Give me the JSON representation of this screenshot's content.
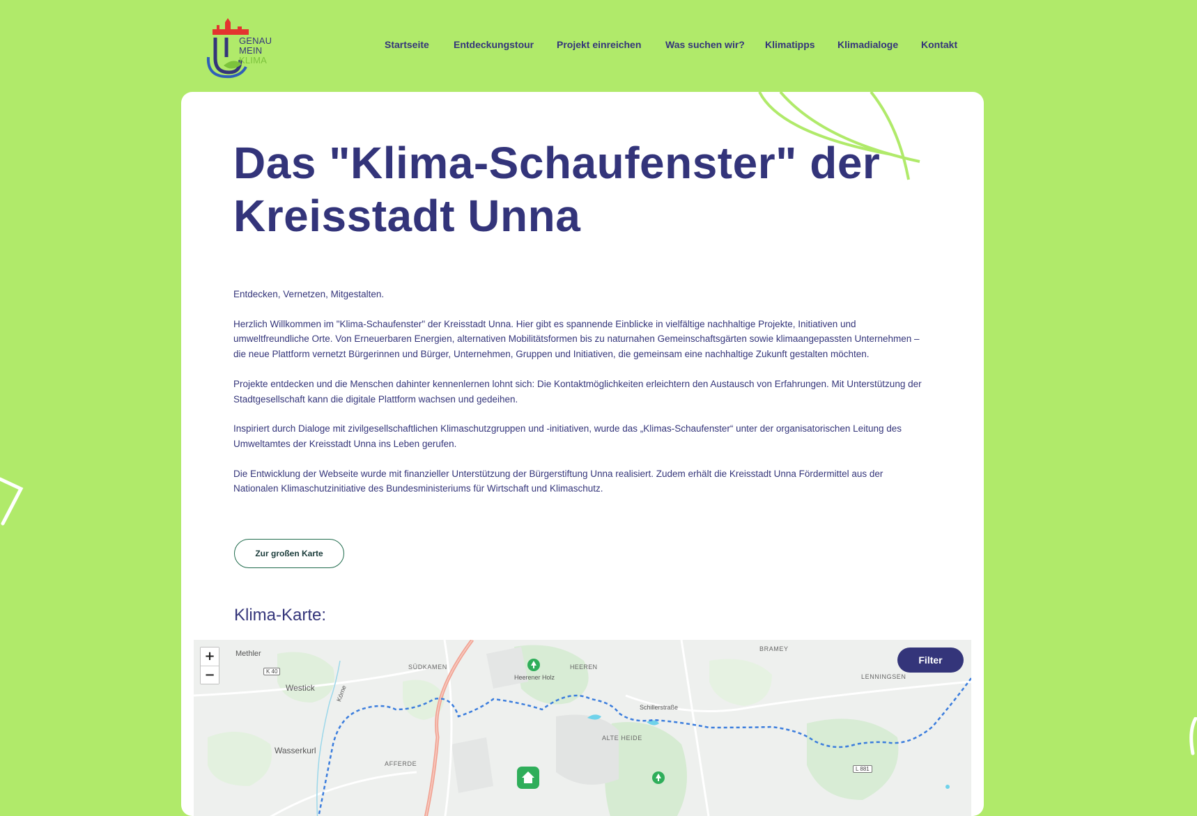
{
  "header": {
    "logo": {
      "line1": "GENAU",
      "line2": "MEIN",
      "line3": "KLIMA"
    },
    "nav": [
      {
        "label": "Startseite"
      },
      {
        "label": "Entdeckungstour"
      },
      {
        "label": "Projekt einreichen"
      },
      {
        "label": "Was suchen wir?"
      },
      {
        "label": "Klimatipps"
      },
      {
        "label": "Klimadialoge"
      },
      {
        "label": "Kontakt"
      }
    ]
  },
  "main": {
    "title_line1": "Das \"Klima-Schaufenster\" der",
    "title_line2": "Kreisstadt Unna",
    "paragraphs": [
      "Entdecken, Vernetzen, Mitgestalten.",
      "Herzlich Willkommen im \"Klima-Schaufenster\" der Kreisstadt Unna. Hier gibt es spannende Einblicke in vielfältige nachhaltige Projekte, Initiativen und umweltfreundliche Orte. Von Erneuerbaren Energien, alternativen Mobilitätsformen bis zu naturnahen Gemeinschaftsgärten sowie klimaangepassten Unternehmen – die neue Plattform vernetzt Bürgerinnen und Bürger, Unternehmen, Gruppen und Initiativen, die gemeinsam eine nachhaltige Zukunft gestalten möchten.",
      "Projekte entdecken und die Menschen dahinter kennenlernen lohnt sich: Die Kontaktmöglichkeiten erleichtern den Austausch von Erfahrungen. Mit Unterstützung der Stadtgesellschaft kann die digitale Plattform wachsen und gedeihen.",
      "Inspiriert durch Dialoge mit zivilgesellschaftlichen Klimaschutzgruppen und -initiativen, wurde das „Klimas-Schaufenster“ unter der organisatorischen Leitung des Umweltamtes der Kreisstadt Unna ins Leben gerufen.",
      "Die Entwicklung der Webseite wurde mit finanzieller Unterstützung der Bürgerstiftung Unna realisiert. Zudem erhält die Kreisstadt Unna Fördermittel aus der Nationalen Klimaschutzinitiative des Bundesministeriums für Wirtschaft und Klimaschutz."
    ],
    "map_button_label": "Zur großen Karte",
    "map_heading": "Klima-Karte:"
  },
  "map": {
    "zoom_in": "+",
    "zoom_out": "−",
    "filter_label": "Filter",
    "labels": {
      "methler": "Methler",
      "westick": "Westick",
      "wasserkurl": "Wasserkurl",
      "suedkamen": "SÜDKAMEN",
      "afferde": "AFFERDE",
      "heerener_holz": "Heerener Holz",
      "heeren": "HEEREN",
      "alte_heide": "ALTE HEIDE",
      "schillerstrasse": "Schillerstraße",
      "bramey": "BRAMEY",
      "lenningsen": "LENNINGSEN",
      "koerne": "Körne",
      "k40": "K 40",
      "l881": "L 881"
    },
    "colors": {
      "route": "#3b7ddd",
      "highway": "#f0a090",
      "poi": "#2fae5a",
      "forest": "#d8ecd5"
    }
  }
}
